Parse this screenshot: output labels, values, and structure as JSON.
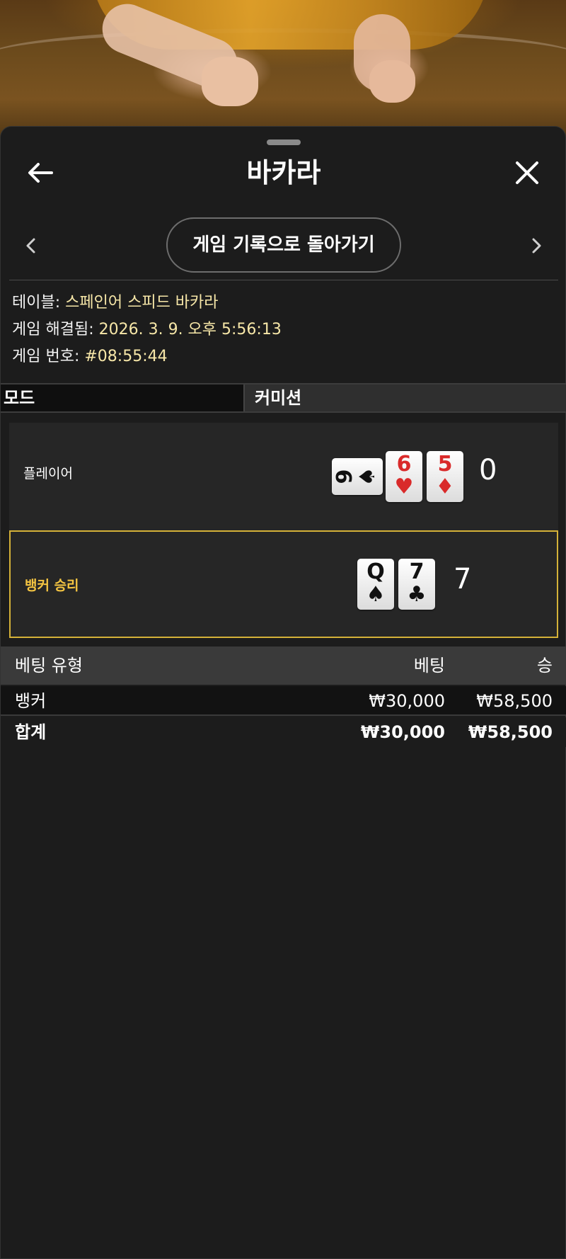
{
  "header": {
    "title": "바카라"
  },
  "nav": {
    "back_to_history": "게임 기록으로 돌아가기"
  },
  "info": {
    "table_label": "테이블:",
    "table_value": "스페인어 스피드 바카라",
    "resolved_label": "게임 해결됨:",
    "resolved_value": "2026. 3. 9. 오후 5:56:13",
    "number_label": "게임 번호:",
    "number_value": "#08:55:44"
  },
  "mode": {
    "mode_label": "모드",
    "commission_label": "커미션"
  },
  "player": {
    "label": "플레이어",
    "score": "0",
    "cards": [
      {
        "rank": "9",
        "suit": "♠",
        "color": "black",
        "rotated": true
      },
      {
        "rank": "6",
        "suit": "♥",
        "color": "red",
        "rotated": false
      },
      {
        "rank": "5",
        "suit": "♦",
        "color": "red",
        "rotated": false
      }
    ]
  },
  "banker": {
    "label": "뱅커 승리",
    "score": "7",
    "cards": [
      {
        "rank": "Q",
        "suit": "♠",
        "color": "black",
        "rotated": false
      },
      {
        "rank": "7",
        "suit": "♣",
        "color": "black",
        "rotated": false
      }
    ]
  },
  "bets": {
    "headers": {
      "type": "베팅 유형",
      "bet": "베팅",
      "win": "승"
    },
    "rows": [
      {
        "type": "뱅커",
        "bet": "₩30,000",
        "win": "₩58,500"
      }
    ],
    "total": {
      "type": "합계",
      "bet": "₩30,000",
      "win": "₩58,500"
    }
  },
  "colors": {
    "accent_gold": "#d4b138",
    "value_text": "#f7e7a8",
    "sheet_bg": "#1c1c1c"
  },
  "icons": {
    "back": "arrow-left-icon",
    "close": "close-icon",
    "prev": "chevron-left-icon",
    "next": "chevron-right-icon"
  }
}
